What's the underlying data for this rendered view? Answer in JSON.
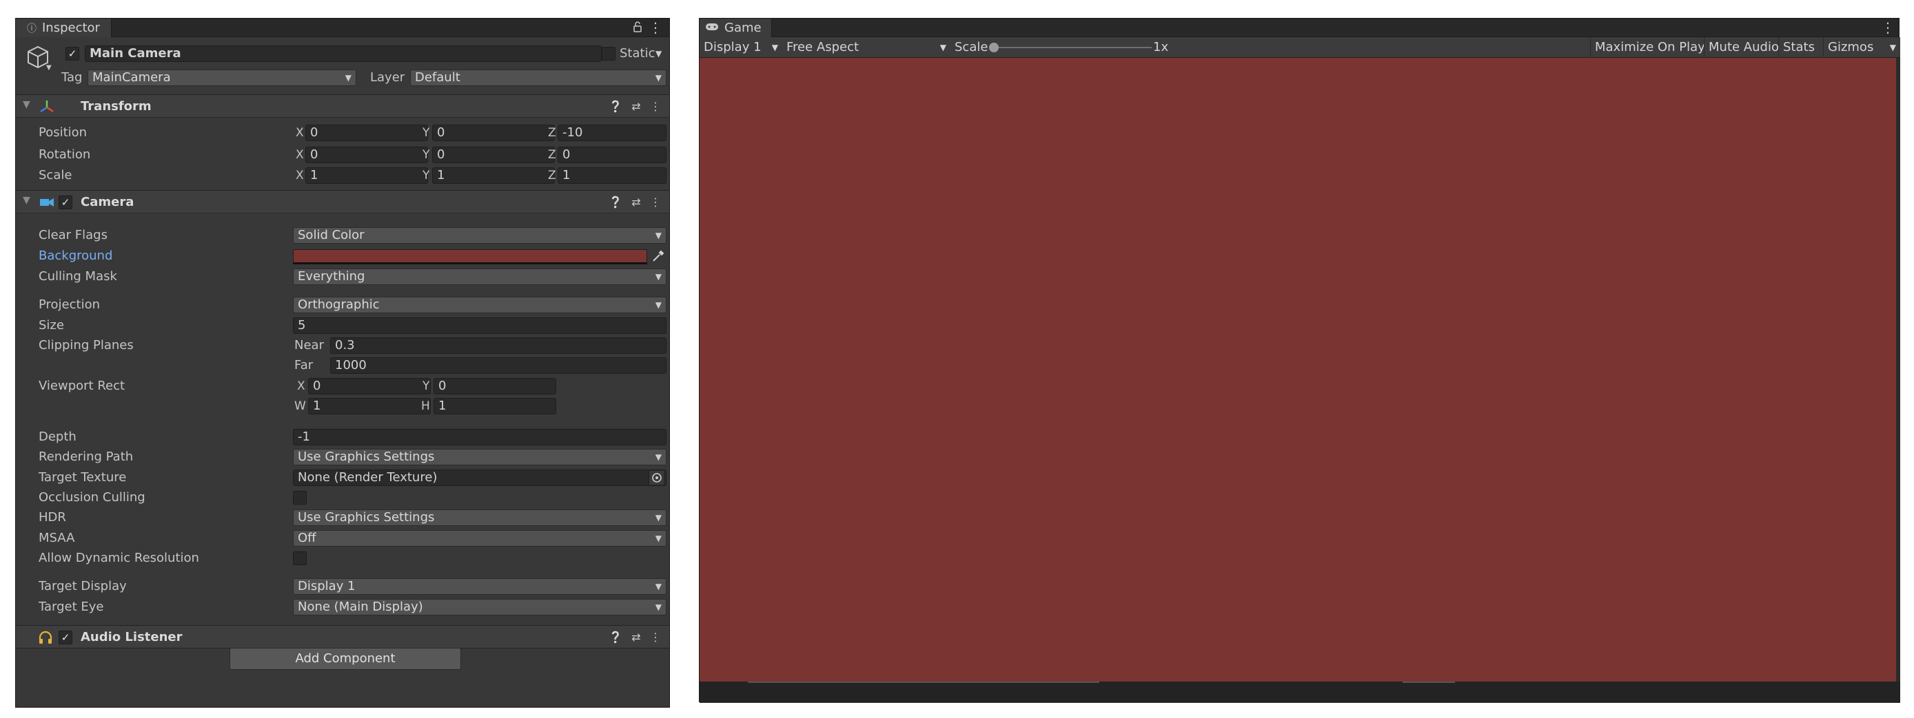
{
  "inspector": {
    "tab_title": "Inspector",
    "object": {
      "enabled": true,
      "name": "Main Camera",
      "static_label": "Static",
      "tag_label": "Tag",
      "tag_value": "MainCamera",
      "layer_label": "Layer",
      "layer_value": "Default"
    },
    "transform": {
      "title": "Transform",
      "rows": [
        {
          "label": "Position",
          "x": "0",
          "y": "0",
          "z": "-10"
        },
        {
          "label": "Rotation",
          "x": "0",
          "y": "0",
          "z": "0"
        },
        {
          "label": "Scale",
          "x": "1",
          "y": "1",
          "z": "1"
        }
      ]
    },
    "camera": {
      "title": "Camera",
      "enabled": true,
      "clear_flags": {
        "label": "Clear Flags",
        "value": "Solid Color"
      },
      "background": {
        "label": "Background",
        "color": "#7a3432"
      },
      "culling_mask": {
        "label": "Culling Mask",
        "value": "Everything"
      },
      "projection": {
        "label": "Projection",
        "value": "Orthographic"
      },
      "size": {
        "label": "Size",
        "value": "5"
      },
      "clipping": {
        "label": "Clipping Planes",
        "near_label": "Near",
        "near": "0.3",
        "far_label": "Far",
        "far": "1000"
      },
      "viewport": {
        "label": "Viewport Rect",
        "x": "0",
        "y": "0",
        "w": "1",
        "h": "1"
      },
      "depth": {
        "label": "Depth",
        "value": "-1"
      },
      "rendering_path": {
        "label": "Rendering Path",
        "value": "Use Graphics Settings"
      },
      "target_texture": {
        "label": "Target Texture",
        "value": "None (Render Texture)"
      },
      "occlusion_culling": {
        "label": "Occlusion Culling",
        "checked": false
      },
      "hdr": {
        "label": "HDR",
        "value": "Use Graphics Settings"
      },
      "msaa": {
        "label": "MSAA",
        "value": "Off"
      },
      "dynamic_resolution": {
        "label": "Allow Dynamic Resolution",
        "checked": false
      },
      "target_display": {
        "label": "Target Display",
        "value": "Display 1"
      },
      "target_eye": {
        "label": "Target Eye",
        "value": "None (Main Display)"
      }
    },
    "audio_listener": {
      "title": "Audio Listener",
      "enabled": true
    },
    "add_component_label": "Add Component"
  },
  "game": {
    "tab_title": "Game",
    "display": "Display 1",
    "aspect": "Free Aspect",
    "scale_label": "Scale",
    "scale_value": "1x",
    "maximize_label": "Maximize On Play",
    "mute_label": "Mute Audio",
    "stats_label": "Stats",
    "gizmos_label": "Gizmos",
    "viewport_color": "#7a3432"
  },
  "axis_labels": {
    "x": "X",
    "y": "Y",
    "z": "Z",
    "w": "W",
    "h": "H"
  }
}
